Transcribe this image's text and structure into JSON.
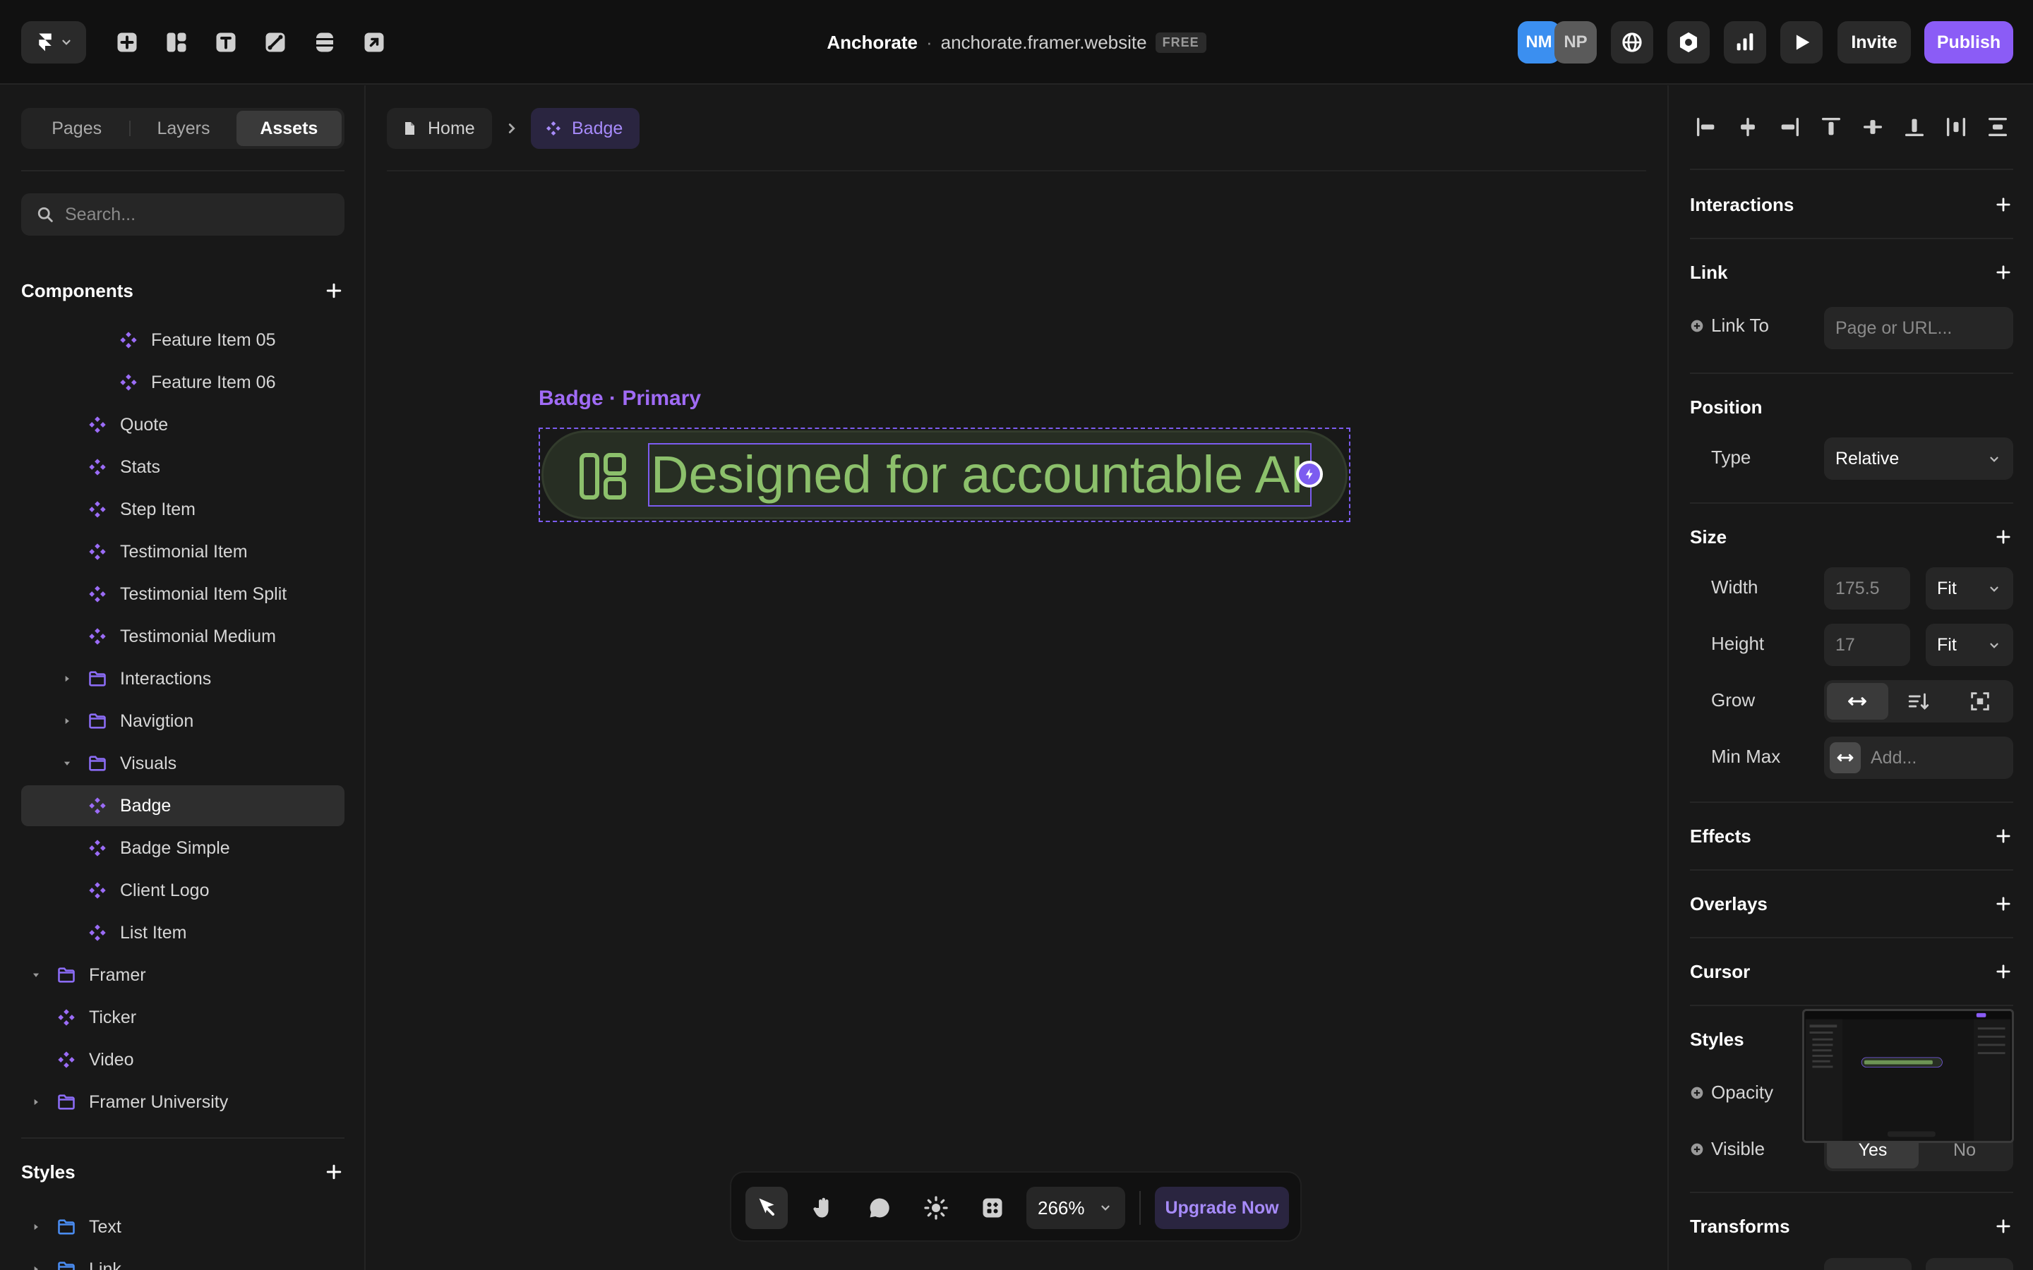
{
  "topbar": {
    "project_name": "Anchorate",
    "separator": "·",
    "url": "anchorate.framer.website",
    "plan_badge": "FREE",
    "avatars": [
      {
        "initials": "NM",
        "color": "#3b8ff0"
      },
      {
        "initials": "NP",
        "color": "#5a5a5a"
      }
    ],
    "invite_label": "Invite",
    "publish_label": "Publish"
  },
  "left_panel": {
    "tabs": [
      {
        "label": "Pages",
        "active": false
      },
      {
        "label": "Layers",
        "active": false
      },
      {
        "label": "Assets",
        "active": true
      }
    ],
    "search_placeholder": "Search...",
    "components_title": "Components",
    "tree": [
      {
        "label": "Feature Item 05",
        "type": "component",
        "indent": 3
      },
      {
        "label": "Feature Item 06",
        "type": "component",
        "indent": 3
      },
      {
        "label": "Quote",
        "type": "component",
        "indent": 2
      },
      {
        "label": "Stats",
        "type": "component",
        "indent": 2
      },
      {
        "label": "Step Item",
        "type": "component",
        "indent": 2
      },
      {
        "label": "Testimonial Item",
        "type": "component",
        "indent": 2
      },
      {
        "label": "Testimonial Item Split",
        "type": "component",
        "indent": 2
      },
      {
        "label": "Testimonial Medium",
        "type": "component",
        "indent": 2
      },
      {
        "label": "Interactions",
        "type": "folder",
        "indent": 1,
        "expanded": false
      },
      {
        "label": "Navigtion",
        "type": "folder",
        "indent": 1,
        "expanded": false
      },
      {
        "label": "Visuals",
        "type": "folder",
        "indent": 1,
        "expanded": true
      },
      {
        "label": "Badge",
        "type": "component",
        "indent": 2,
        "selected": true
      },
      {
        "label": "Badge Simple",
        "type": "component",
        "indent": 2
      },
      {
        "label": "Client Logo",
        "type": "component",
        "indent": 2
      },
      {
        "label": "List Item",
        "type": "component",
        "indent": 2
      },
      {
        "label": "Framer",
        "type": "folder",
        "indent": 0,
        "expanded": true
      },
      {
        "label": "Ticker",
        "type": "component",
        "indent": 1
      },
      {
        "label": "Video",
        "type": "component",
        "indent": 1
      },
      {
        "label": "Framer University",
        "type": "folder",
        "indent": 0,
        "expanded": false
      }
    ],
    "styles_title": "Styles",
    "styles_tree": [
      {
        "label": "Text",
        "type": "style-folder"
      },
      {
        "label": "Link",
        "type": "style-folder"
      }
    ]
  },
  "canvas": {
    "breadcrumb_home": "Home",
    "breadcrumb_current": "Badge",
    "frame_label": "Badge · Primary",
    "badge_text": "Designed for accountable AI",
    "zoom": "266%",
    "upgrade_label": "Upgrade Now"
  },
  "right_panel": {
    "interactions": "Interactions",
    "link": "Link",
    "link_to_label": "Link To",
    "link_to_placeholder": "Page or URL...",
    "position": "Position",
    "type_label": "Type",
    "type_value": "Relative",
    "size": "Size",
    "width_label": "Width",
    "width_value": "175.5",
    "width_mode": "Fit",
    "height_label": "Height",
    "height_value": "17",
    "height_mode": "Fit",
    "grow_label": "Grow",
    "minmax_label": "Min Max",
    "minmax_placeholder": "Add...",
    "effects": "Effects",
    "overlays": "Overlays",
    "cursor": "Cursor",
    "styles": "Styles",
    "opacity_label": "Opacity",
    "visible_label": "Visible",
    "visible_yes": "Yes",
    "visible_no": "No",
    "transforms": "Transforms"
  },
  "colors": {
    "accent": "#8b5cf6",
    "component_icon": "#9b6cf7",
    "folder_icon": "#8b6cf5",
    "style_folder_icon": "#4a8cf0",
    "badge_text": "#8cc06b"
  }
}
